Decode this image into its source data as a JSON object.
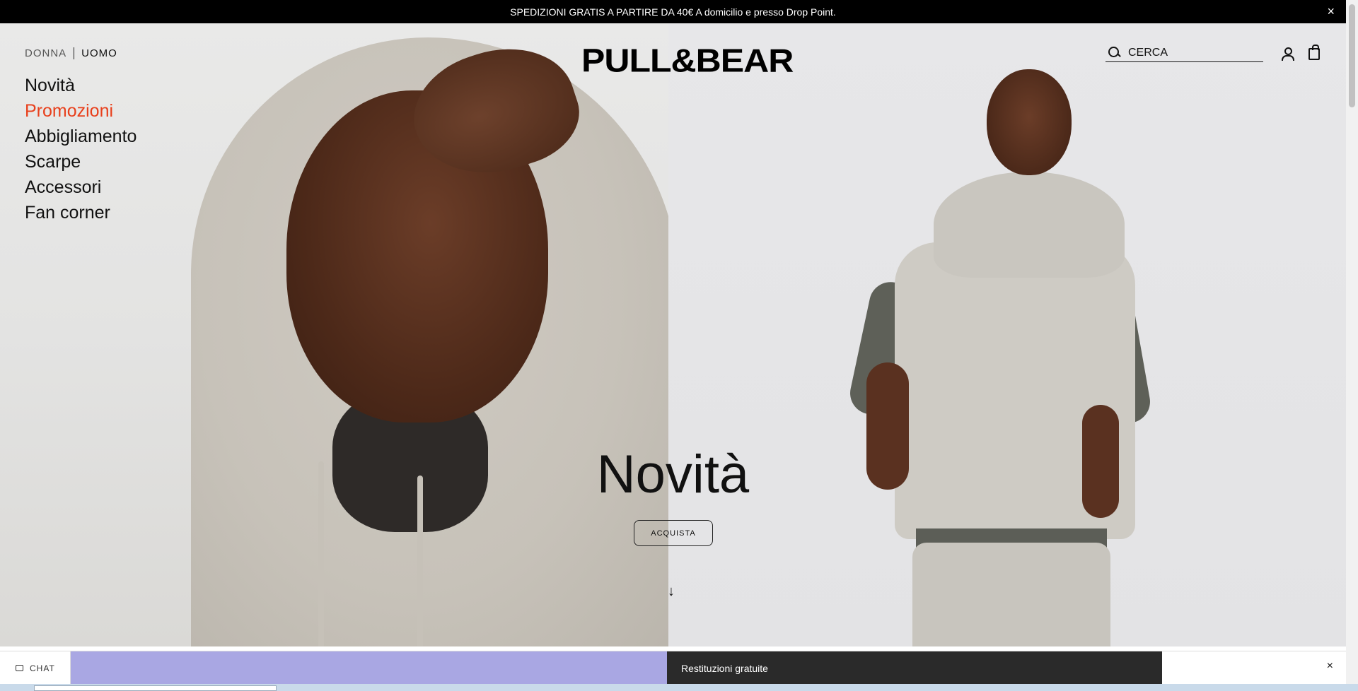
{
  "announcement": {
    "text": "SPEDIZIONI GRATIS A PARTIRE DA 40€ A domicilio e presso Drop Point.",
    "close": "×"
  },
  "header": {
    "gender": {
      "donna": "DONNA",
      "uomo": "UOMO"
    },
    "logo": "PULL&BEAR",
    "search_placeholder": "CERCA",
    "icons": [
      "search-icon",
      "user-icon",
      "bag-icon"
    ]
  },
  "nav": {
    "items": [
      "Novità",
      "Promozioni",
      "Abbigliamento",
      "Scarpe",
      "Accessori",
      "Fan corner"
    ],
    "highlight_color": "#e8401c"
  },
  "hero": {
    "title": "Novità",
    "button": "ACQUISTA",
    "arrow": "↓"
  },
  "bottom": {
    "chat": "CHAT",
    "banner": "Restituzioni gratuite",
    "close": "×",
    "accent": "#a9a7e3"
  }
}
